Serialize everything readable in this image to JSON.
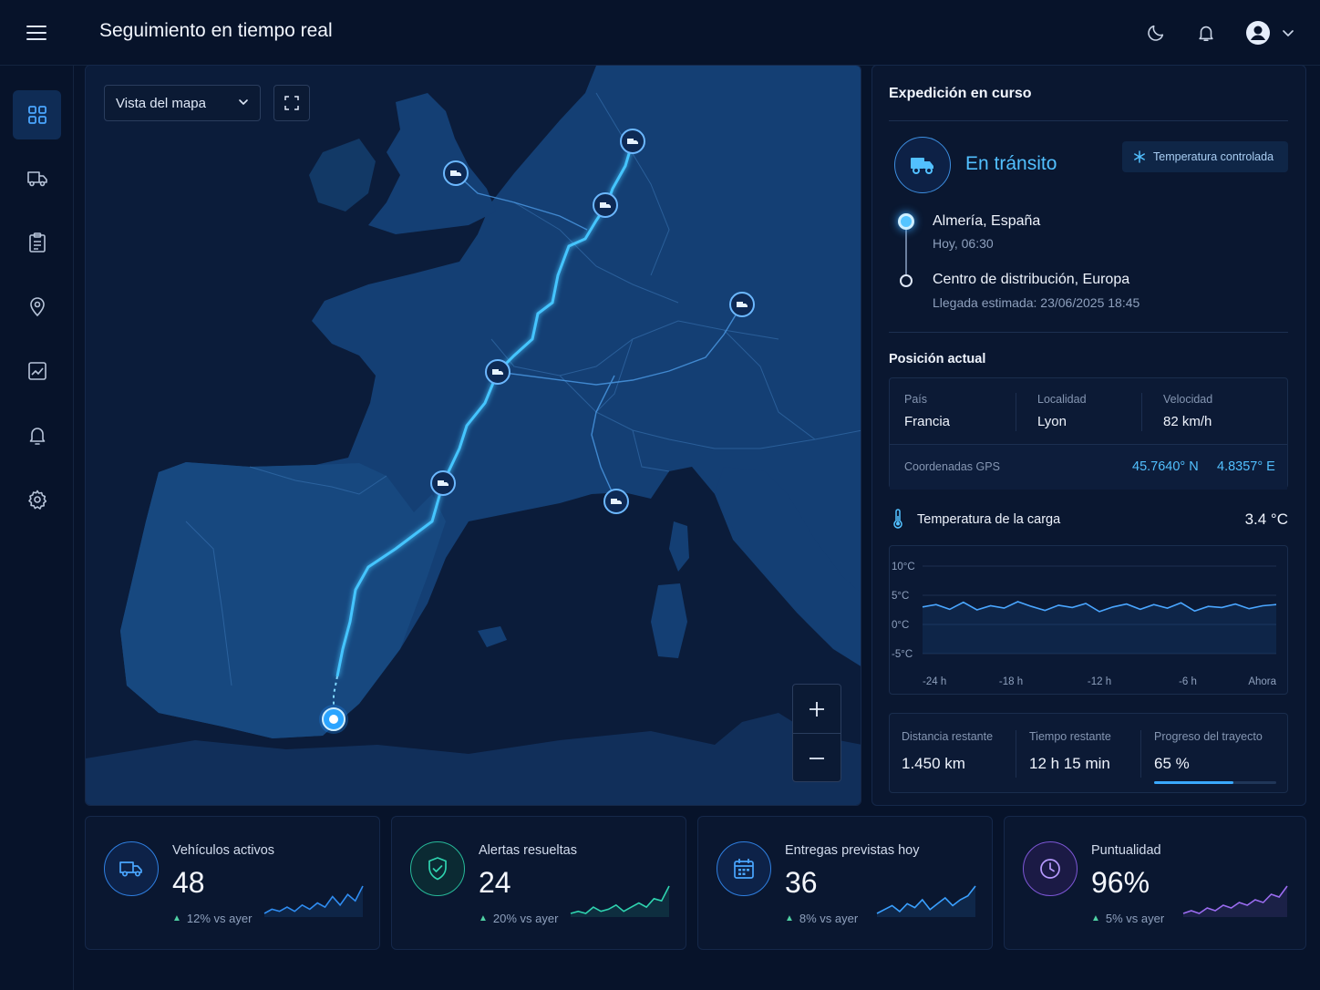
{
  "header": {
    "title": "Seguimiento en tiempo real"
  },
  "icons": {
    "menu": "menu-icon",
    "theme": "moon-icon",
    "notifications": "bell-icon",
    "account": "user-circle-icon",
    "sidebar": [
      "dashboard-icon",
      "truck-icon",
      "clipboard-icon",
      "map-pin-icon",
      "chart-icon",
      "bell-icon",
      "gear-icon"
    ]
  },
  "map": {
    "view_select": "Vista del mapa",
    "zoom_in": "+",
    "zoom_out": "−"
  },
  "shipment": {
    "title": "Expedición en curso",
    "status": "En tránsito",
    "badge": "Temperatura controlada",
    "origin": {
      "name": "Almería, España",
      "time": "Hoy, 06:30"
    },
    "destination": {
      "name": "Centro de distribución, Europa",
      "eta": "Llegada estimada: 23/06/2025 18:45"
    },
    "position": {
      "title": "Posición actual",
      "country_label": "País",
      "country": "Francia",
      "city_label": "Localidad",
      "city": "Lyon",
      "speed_label": "Velocidad",
      "speed": "82 km/h",
      "gps_label": "Coordenadas GPS",
      "lat": "45.7640° N",
      "lon": "4.8357° E"
    },
    "temperature": {
      "title": "Temperatura de la carga",
      "current": "3.4 °C"
    },
    "stats": {
      "distance_label": "Distancia restante",
      "distance": "1.450 km",
      "time_label": "Tiempo restante",
      "time": "12 h 15 min",
      "progress_label": "Progreso del trayecto",
      "progress": "65 %",
      "progress_fraction": 0.65
    }
  },
  "chart_data": {
    "type": "line",
    "title": "Temperatura de la carga",
    "x": [
      "-24 h",
      "-18 h",
      "-12 h",
      "-6 h",
      "Ahora"
    ],
    "xlabel": "",
    "ylabel": "",
    "yticks": [
      "10°C",
      "5°C",
      "0°C",
      "-5°C"
    ],
    "ylim": [
      -5,
      10
    ],
    "grid": true,
    "series": [
      {
        "values": [
          3.0,
          3.4,
          2.6,
          3.8,
          2.5,
          3.2,
          2.8,
          3.9,
          3.1,
          2.4,
          3.3,
          2.9,
          3.6,
          2.2,
          3.0,
          3.5,
          2.6,
          3.4,
          2.8,
          3.7,
          2.3,
          3.1,
          2.9,
          3.5,
          2.7,
          3.2,
          3.4
        ]
      }
    ]
  },
  "kpis": [
    {
      "label": "Vehículos activos",
      "value": "48",
      "trend": "12% vs ayer",
      "icon": "truck-icon",
      "color": "#2f8cf0",
      "spark": [
        5,
        7,
        6,
        8,
        6,
        9,
        7,
        10,
        8,
        13,
        9,
        14,
        11,
        18
      ]
    },
    {
      "label": "Alertas resueltas",
      "value": "24",
      "trend": "20% vs ayer",
      "icon": "shield-check-icon",
      "color": "#2fd4b0",
      "spark": [
        5,
        6,
        5,
        8,
        6,
        7,
        9,
        6,
        8,
        10,
        8,
        12,
        11,
        18
      ]
    },
    {
      "label": "Entregas previstas hoy",
      "value": "36",
      "trend": "8% vs ayer",
      "icon": "calendar-icon",
      "color": "#3aa0ff",
      "spark": [
        5,
        7,
        9,
        6,
        10,
        8,
        12,
        7,
        10,
        13,
        9,
        12,
        14,
        19
      ]
    },
    {
      "label": "Puntualidad",
      "value": "96%",
      "trend": "5% vs ayer",
      "icon": "clock-icon",
      "color": "#9b6cf0",
      "spark": [
        6,
        7,
        6,
        8,
        7,
        9,
        8,
        10,
        9,
        11,
        10,
        13,
        12,
        16
      ]
    }
  ]
}
